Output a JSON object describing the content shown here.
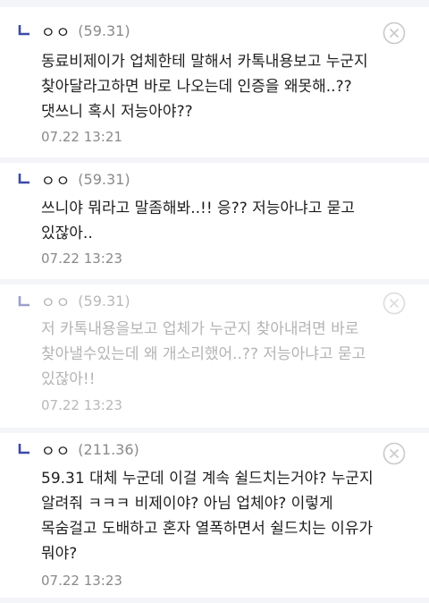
{
  "comments": [
    {
      "author": "ㅇㅇ",
      "ip": "(59.31)",
      "text": "동료비제이가 업체한테 말해서 카톡내용보고 누군지 찾아달라고하면 바로 나오는데 인증을 왜못해..?? 댓쓰니 혹시 저능아야??",
      "time": "07.22 13:21"
    },
    {
      "author": "ㅇㅇ",
      "ip": "(59.31)",
      "text": "쓰니야 뭐라고 말좀해봐..!! 응?? 저능아냐고 묻고 있잖아..",
      "time": "07.22 13:23"
    },
    {
      "author": "ㅇㅇ",
      "ip": "(59.31)",
      "text": "저 카톡내용을보고 업체가 누군지 찾아내려면 바로 찾아낼수있는데 왜 개소리했어..?? 저능아냐고 묻고 있잖아!!",
      "time": "07.22 13:23"
    },
    {
      "author": "ㅇㅇ",
      "ip": "(211.36)",
      "text": "59.31 대체 누군데 이걸 계속 쉴드치는거야? 누군지 알려줘 ㅋㅋㅋ 비제이야? 아님 업체야? 이렇게 목숨걸고 도배하고 혼자 열폭하면서 쉴드치는 이유가 뭐야?",
      "time": "07.22 13:23"
    }
  ],
  "colors": {
    "background": "#f4f5f8",
    "card": "#ffffff",
    "reply_icon": "#3b4aa8",
    "muted": "#8a8a8a"
  },
  "icons": {
    "reply": "reply-arrow-icon",
    "delete": "close-circle-icon"
  }
}
